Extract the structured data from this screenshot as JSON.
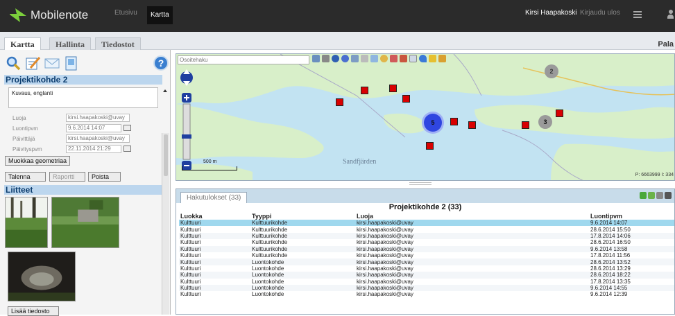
{
  "header": {
    "app_name": "Mobilenote",
    "logo_icon": "mobilenote-arrow-icon",
    "nav": [
      "Etusivu",
      "Kartta"
    ],
    "user": "Kirsi Haapakoski",
    "logout": "Kirjaudu ulos",
    "menu_icon": "hamburger-menu-icon",
    "profile_icon": "user-icon"
  },
  "tabs": [
    "Kartta",
    "Hallinta",
    "Tiedostot"
  ],
  "right_label": "Pala",
  "left": {
    "toolbar_icons": [
      "search-icon",
      "edit-form-icon",
      "mail-icon",
      "document-icon",
      "help-icon"
    ],
    "help_symbol": "?",
    "title": "Projektikohde 2",
    "description_label": "Kuvaus, englanti",
    "fields": [
      {
        "label": "Luoja",
        "value": "kirsi.haapakoski@uvay"
      },
      {
        "label": "Luontipvm",
        "value": "9.6.2014 14:07"
      },
      {
        "label": "Päivittäjä",
        "value": "kirsi.haapakoski@uvay"
      },
      {
        "label": "Päivityspvm",
        "value": "22.11.2014 21:29"
      }
    ],
    "edit_geometry": "Muokkaa geometriaa",
    "save": "Talenna",
    "report": "Raportti",
    "delete": "Poista",
    "attachments_title": "Liitteet",
    "add_file": "Lisää tiedosto"
  },
  "map": {
    "search_placeholder": "Osoitehaku",
    "place_labels": [
      "Sandfjärden"
    ],
    "clusters": [
      "2",
      "5",
      "3"
    ],
    "scale": "500 m",
    "coords": "P: 6663999 I: 334"
  },
  "results": {
    "tab": "Hakutulokset (33)",
    "title": "Projektikohde 2 (33)",
    "columns": [
      "Luokka",
      "Tyyppi",
      "Luoja",
      "Luontipvm"
    ],
    "rows": [
      [
        "Kulttuuri",
        "Kulttuurikohde",
        "kirsi.haapakoski@uvay",
        "9.6.2014 14:07"
      ],
      [
        "Kulttuuri",
        "Kulttuurikohde",
        "kirsi.haapakoski@uvay",
        "28.6.2014 15:50"
      ],
      [
        "Kulttuuri",
        "Kulttuurikohde",
        "kirsi.haapakoski@uvay",
        "17.8.2014 14:06"
      ],
      [
        "Kulttuuri",
        "Kulttuurikohde",
        "kirsi.haapakoski@uvay",
        "28.6.2014 16:50"
      ],
      [
        "Kulttuuri",
        "Kulttuurikohde",
        "kirsi.haapakoski@uvay",
        "9.6.2014 13:58"
      ],
      [
        "Kulttuuri",
        "Kulttuurikohde",
        "kirsi.haapakoski@uvay",
        "17.8.2014 11:56"
      ],
      [
        "Kulttuuri",
        "Luontokohde",
        "kirsi.haapakoski@uvay",
        "28.6.2014 13:52"
      ],
      [
        "Kulttuuri",
        "Luontokohde",
        "kirsi.haapakoski@uvay",
        "28.6.2014 13:29"
      ],
      [
        "Kulttuuri",
        "Luontokohde",
        "kirsi.haapakoski@uvay",
        "28.6.2014 18:22"
      ],
      [
        "Kulttuuri",
        "Luontokohde",
        "kirsi.haapakoski@uvay",
        "17.8.2014 13:35"
      ],
      [
        "Kulttuuri",
        "Luontokohde",
        "kirsi.haapakoski@uvay",
        "9.6.2014 14:55"
      ],
      [
        "Kulttuuri",
        "Luontokohde",
        "kirsi.haapakoski@uvay",
        "9.6.2014 12:39"
      ]
    ],
    "toolbar_icons": [
      "download-icon",
      "export-icon",
      "print-icon",
      "list-icon"
    ]
  },
  "colors": {
    "topbar": "#2b2b2b",
    "accent_green": "#7ccf3c",
    "section_header": "#bcd6ee",
    "selected_row": "#9fd8ee",
    "marker_red": "#d80000",
    "cluster_blue": "#2f46e0",
    "water": "#c2e3f2",
    "land": "#d8efc9"
  }
}
